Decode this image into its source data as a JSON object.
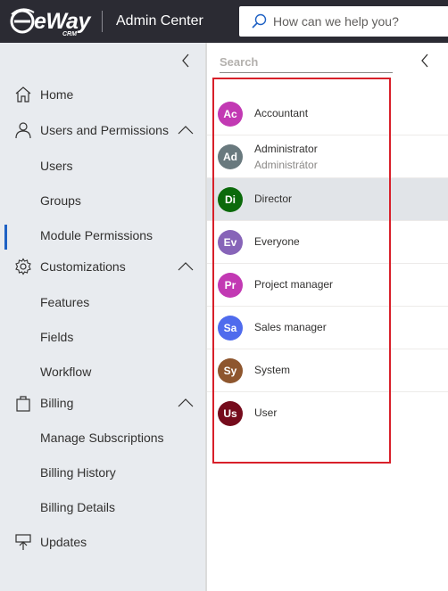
{
  "header": {
    "logo_text": "eWay",
    "logo_sub": "CRM",
    "app_title": "Admin Center",
    "search_placeholder": "How can we help you?"
  },
  "sidebar": {
    "items": [
      {
        "label": "Home",
        "icon": "home-icon"
      },
      {
        "label": "Users and Permissions",
        "icon": "person-icon",
        "expanded": true
      },
      {
        "label": "Users"
      },
      {
        "label": "Groups"
      },
      {
        "label": "Module Permissions",
        "active": true
      },
      {
        "label": "Customizations",
        "icon": "gear-icon",
        "expanded": true
      },
      {
        "label": "Features"
      },
      {
        "label": "Fields"
      },
      {
        "label": "Workflow"
      },
      {
        "label": "Billing",
        "icon": "shopping-bag-icon",
        "expanded": true
      },
      {
        "label": "Manage Subscriptions"
      },
      {
        "label": "Billing History"
      },
      {
        "label": "Billing Details"
      },
      {
        "label": "Updates",
        "icon": "updates-icon"
      }
    ]
  },
  "main": {
    "search_placeholder": "Search",
    "roles": [
      {
        "initials": "Ac",
        "name": "Accountant",
        "color": "#c239b3"
      },
      {
        "initials": "Ad",
        "name": "Administrator",
        "subtitle": "Administrátor",
        "color": "#69797e"
      },
      {
        "initials": "Di",
        "name": "Director",
        "color": "#0b6a0b",
        "selected": true
      },
      {
        "initials": "Ev",
        "name": "Everyone",
        "color": "#8764b8"
      },
      {
        "initials": "Pr",
        "name": "Project manager",
        "color": "#c239b3"
      },
      {
        "initials": "Sa",
        "name": "Sales manager",
        "color": "#4f6bed"
      },
      {
        "initials": "Sy",
        "name": "System",
        "color": "#8e562e"
      },
      {
        "initials": "Us",
        "name": "User",
        "color": "#750b1c"
      }
    ]
  },
  "colors": {
    "topbar": "#2b2b33",
    "sidebar": "#e8ebef",
    "accent": "#1e61c4",
    "highlight": "#d8202a"
  }
}
